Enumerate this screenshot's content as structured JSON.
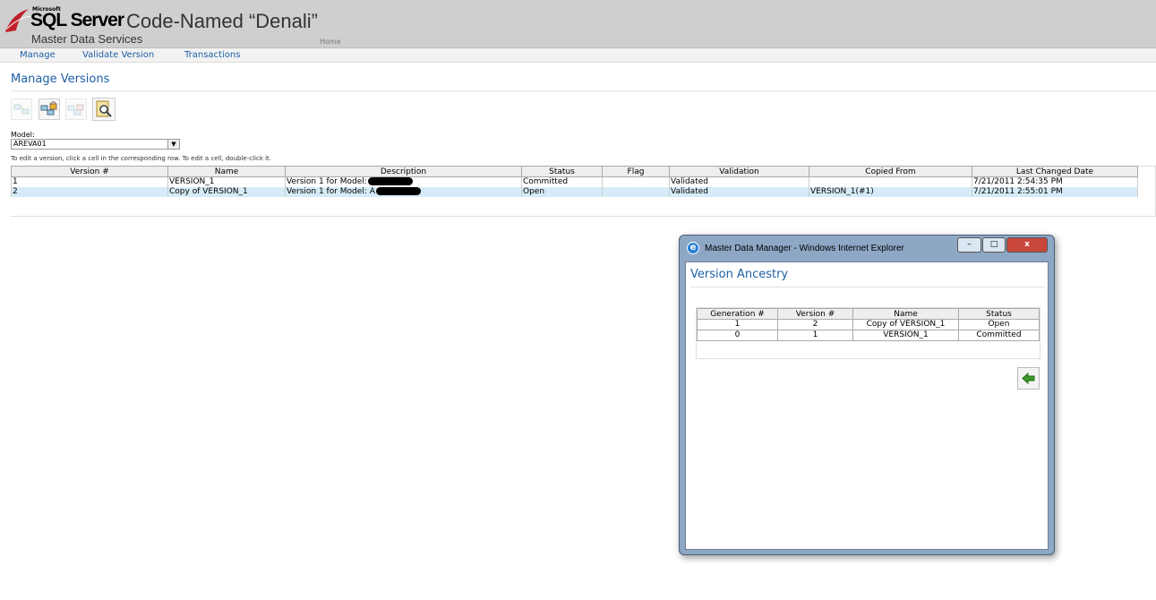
{
  "header": {
    "brand_small": "Microsoft",
    "product": "SQL Server",
    "codename": "Code-Named “Denali”",
    "subtitle": "Master Data Services",
    "home_link": "Home"
  },
  "nav": {
    "items": [
      "Manage",
      "Validate Version",
      "Transactions"
    ]
  },
  "page": {
    "title": "Manage Versions",
    "toolbar": [
      "copy-version-icon",
      "lock-version-icon",
      "unlock-version-icon",
      "version-ancestry-icon"
    ],
    "model_label": "Model:",
    "model_value": "AREVA01",
    "instructions": "To edit a version, click a cell in the corresponding row. To edit a cell, double-click it."
  },
  "versions_table": {
    "columns": [
      "Version #",
      "Name",
      "Description",
      "Status",
      "Flag",
      "Validation",
      "Copied From",
      "Last Changed Date"
    ],
    "rows": [
      {
        "version": "1",
        "name": "VERSION_1",
        "description": "Version 1 for Model:",
        "status": "Committed",
        "flag": "",
        "validation": "Validated",
        "copied_from": "",
        "last_changed": "7/21/2011 2:54:35 PM"
      },
      {
        "version": "2",
        "name": "Copy of VERSION_1",
        "description": "Version 1 for Model: A",
        "status": "Open",
        "flag": "",
        "validation": "Validated",
        "copied_from": "VERSION_1(#1)",
        "last_changed": "7/21/2011 2:55:01 PM"
      }
    ]
  },
  "popup": {
    "window_title": "Master Data Manager - Windows Internet Explorer",
    "minimize": "–",
    "maximize": "□",
    "close": "x",
    "title": "Version Ancestry",
    "columns": [
      "Generation #",
      "Version #",
      "Name",
      "Status"
    ],
    "rows": [
      {
        "generation": "1",
        "version": "2",
        "name": "Copy of VERSION_1",
        "status": "Open"
      },
      {
        "generation": "0",
        "version": "1",
        "name": "VERSION_1",
        "status": "Committed"
      }
    ],
    "back_icon": "back-arrow-icon"
  },
  "colors": {
    "accent": "#1c5fa5",
    "selected_row": "#d6ebf8",
    "header_bg": "#cfcfcf"
  }
}
